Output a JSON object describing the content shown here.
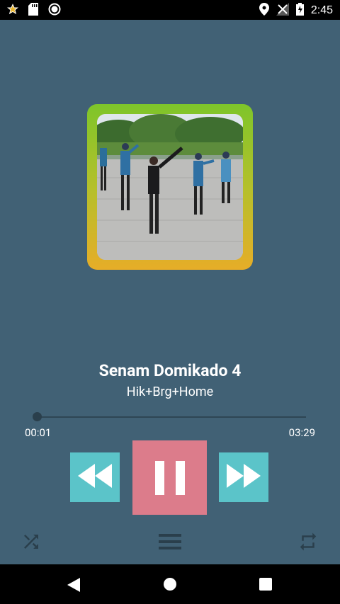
{
  "status_bar": {
    "time": "2:45",
    "left_icons": [
      "star-icon",
      "sd-card-icon",
      "circle-icon"
    ],
    "right_icons": [
      "location-icon",
      "no-signal-icon",
      "battery-charging-icon"
    ]
  },
  "track": {
    "title": "Senam Domikado 4",
    "artist": "Hik+Brg+Home"
  },
  "player": {
    "current_time": "00:01",
    "total_time": "03:29",
    "progress": 0.005
  },
  "controls": {
    "rewind_icon": "rewind-icon",
    "pause_icon": "pause-icon",
    "fast_forward_icon": "fast-forward-icon",
    "shuffle_icon": "shuffle-icon",
    "playlist_icon": "playlist-icon",
    "repeat_icon": "repeat-icon"
  },
  "nav_bar": {
    "icons": [
      "back-icon",
      "home-icon",
      "recents-icon"
    ]
  },
  "colors": {
    "background": "#416175",
    "accent_teal": "#5bc4c9",
    "accent_pink": "#dc7c8b"
  }
}
